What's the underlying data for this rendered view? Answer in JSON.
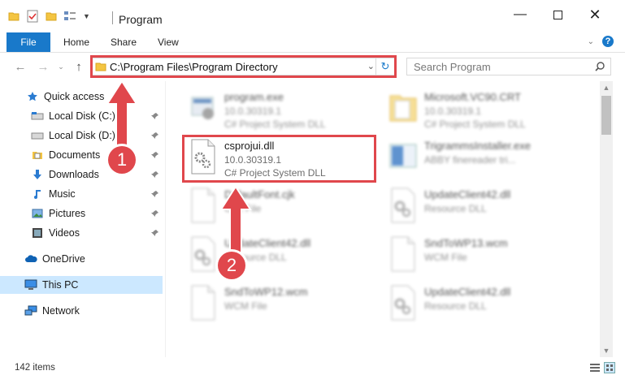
{
  "window": {
    "title": "Program"
  },
  "ribbon": {
    "tabs": [
      {
        "label": "File"
      },
      {
        "label": "Home"
      },
      {
        "label": "Share"
      },
      {
        "label": "View"
      }
    ]
  },
  "address": {
    "path": "C:\\Program Files\\Program Directory"
  },
  "search": {
    "placeholder": "Search Program"
  },
  "nav": {
    "items": [
      {
        "label": "Quick access",
        "icon": "star-icon"
      },
      {
        "label": "Local Disk (C:)",
        "icon": "drive-icon"
      },
      {
        "label": "Local Disk (D:)",
        "icon": "drive-icon"
      },
      {
        "label": "Documents",
        "icon": "documents-icon"
      },
      {
        "label": "Downloads",
        "icon": "download-icon"
      },
      {
        "label": "Music",
        "icon": "music-icon"
      },
      {
        "label": "Pictures",
        "icon": "pictures-icon"
      },
      {
        "label": "Videos",
        "icon": "videos-icon"
      },
      {
        "label": "OneDrive",
        "icon": "cloud-icon"
      },
      {
        "label": "This PC",
        "icon": "computer-icon"
      },
      {
        "label": "Network",
        "icon": "network-icon"
      }
    ]
  },
  "files": [
    {
      "name": "program.exe",
      "line1": "10.0.30319.1",
      "line2": "C# Project System DLL",
      "icon": "exe-icon"
    },
    {
      "name": "Microsoft.VC90.CRT",
      "line1": "10.0.30319.1",
      "line2": "C# Project System DLL",
      "icon": "folder-icon"
    },
    {
      "name": "csprojui.dll",
      "line1": "10.0.30319.1",
      "line2": "C# Project System DLL",
      "icon": "dll-gear-icon"
    },
    {
      "name": "TrigrammsInstaller.exe",
      "line1": "ABBY finereader tri...",
      "line2": "",
      "icon": "installer-icon"
    },
    {
      "name": "DefaultFont.cjk",
      "line1": "CJK File",
      "line2": "",
      "icon": "file-icon"
    },
    {
      "name": "UpdateClient42.dll",
      "line1": "Resource DLL",
      "line2": "",
      "icon": "dll-gear-icon"
    },
    {
      "name": "UpdateClient42.dll",
      "line1": "Resource DLL",
      "line2": "",
      "icon": "dll-gear-icon"
    },
    {
      "name": "SndToWP13.wcm",
      "line1": "WCM File",
      "line2": "",
      "icon": "file-icon"
    },
    {
      "name": "SndToWP12.wcm",
      "line1": "WCM File",
      "line2": "",
      "icon": "file-icon"
    },
    {
      "name": "UpdateClient42.dll",
      "line1": "Resource DLL",
      "line2": "",
      "icon": "dll-gear-icon"
    }
  ],
  "status": {
    "count": "142 items"
  },
  "annotations": {
    "step1": "1",
    "step2": "2"
  },
  "colors": {
    "accent": "#1979ca",
    "highlight": "#e0474c",
    "selected": "#cce8ff"
  }
}
